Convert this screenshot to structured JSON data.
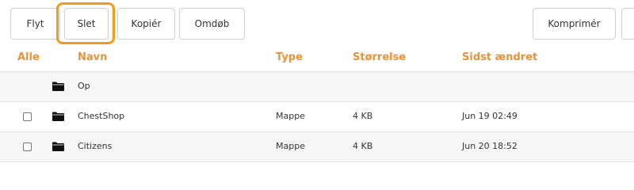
{
  "toolbar": {
    "move_label": "Flyt",
    "delete_label": "Slet",
    "copy_label": "Kopiér",
    "rename_label": "Omdøb",
    "compress_label": "Komprimér"
  },
  "focus_color": "#f29a1e",
  "table": {
    "headers": {
      "all": "Alle",
      "name": "Navn",
      "type": "Type",
      "size": "Størrelse",
      "modified": "Sidst ændret"
    },
    "header_color": "#e8933a",
    "up_row": {
      "icon": "folder-icon",
      "label": "Op"
    },
    "rows": [
      {
        "icon": "folder-icon",
        "name": "ChestShop",
        "type": "Mappe",
        "size": "4 KB",
        "modified": "Jun 19 02:49"
      },
      {
        "icon": "folder-icon",
        "name": "Citizens",
        "type": "Mappe",
        "size": "4 KB",
        "modified": "Jun 20 18:52"
      }
    ]
  }
}
